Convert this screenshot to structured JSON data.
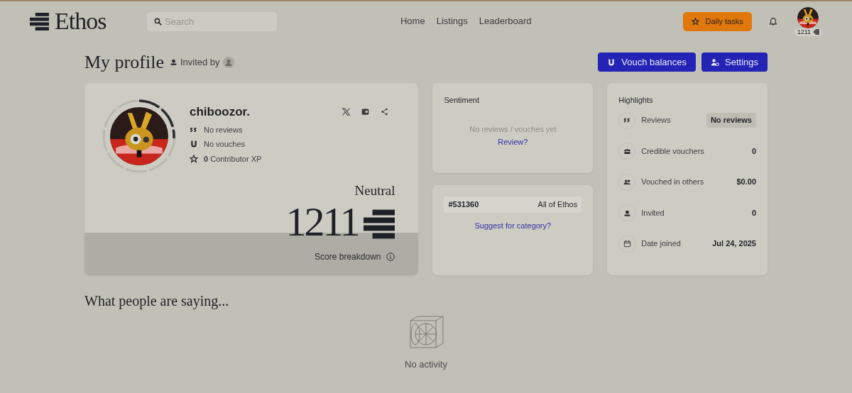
{
  "header": {
    "logo": "Ethos",
    "search": {
      "placeholder": "Search"
    },
    "nav": [
      {
        "label": "Home",
        "selected": false
      },
      {
        "label": "Listings",
        "selected": false
      },
      {
        "label": "Leaderboard",
        "selected": false
      }
    ],
    "daily_tasks": "Daily tasks",
    "avatar_score": "1211"
  },
  "page": {
    "title": "My profile",
    "invited_by": "Invited by",
    "buttons": [
      {
        "kind": "vouch",
        "label": "Vouch balances"
      },
      {
        "kind": "settings",
        "label": "Settings"
      }
    ]
  },
  "profile": {
    "name": "chiboozor.",
    "stats": [
      {
        "kind": "reviews",
        "text": "No reviews"
      },
      {
        "kind": "vouch",
        "text": "No vouches"
      },
      {
        "kind": "xp",
        "text": "**0** Contributor XP"
      }
    ],
    "score_level": "Neutral",
    "score": "1211",
    "breakdown": "Score breakdown"
  },
  "sentiment": {
    "title": "Sentiment",
    "empty": "No reviews / vouches yet",
    "link": "Review?"
  },
  "rank": {
    "position": "#531360",
    "scope": "All of Ethos",
    "link": "Suggest for category?"
  },
  "highlights": {
    "title": "Highlights",
    "items": [
      {
        "kind": "reviews",
        "label": "Reviews",
        "value": "No reviews",
        "pill": true
      },
      {
        "kind": "vouchers",
        "label": "Credible vouchers",
        "value": "0",
        "pill": false
      },
      {
        "kind": "people",
        "label": "Vouched in others",
        "value": "$0.00",
        "pill": false
      },
      {
        "kind": "invited",
        "label": "Invited",
        "value": "0",
        "pill": false
      },
      {
        "kind": "calendar",
        "label": "Date joined",
        "value": "Jul 24, 2025",
        "pill": false
      }
    ]
  },
  "activity": {
    "title": "What people are saying...",
    "empty": "No activity"
  }
}
